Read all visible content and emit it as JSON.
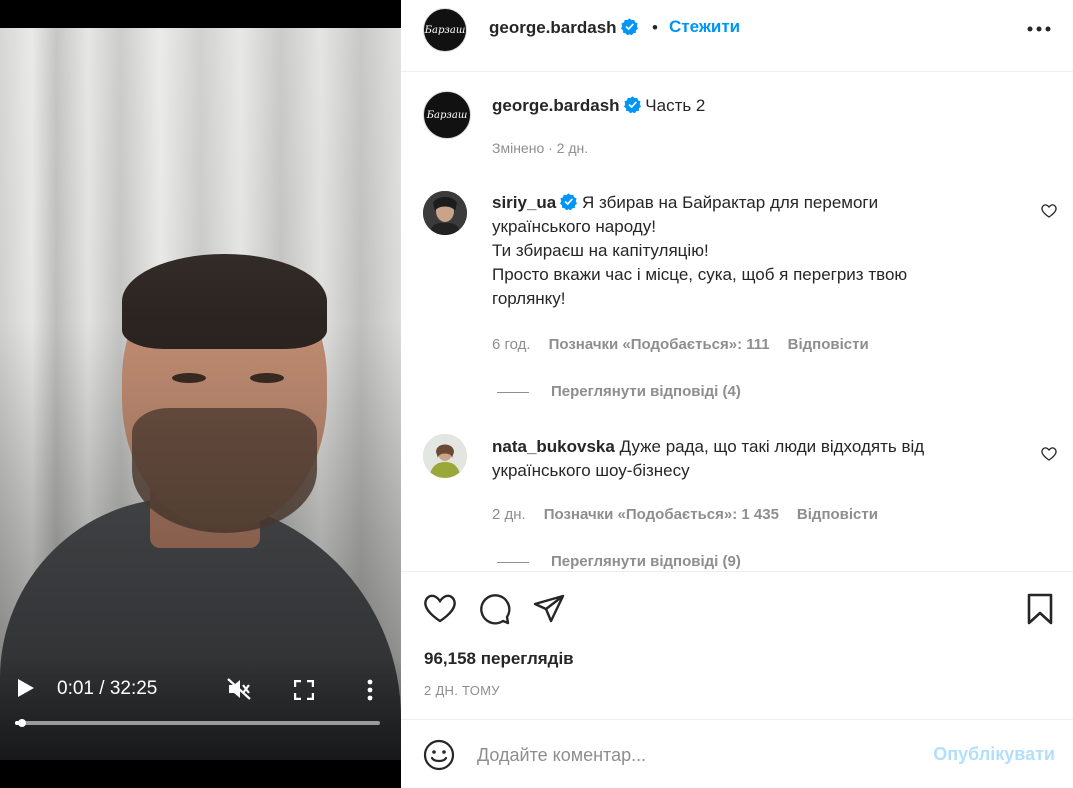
{
  "video": {
    "time_display": "0:01 / 32:25",
    "progress_fraction": 0.003,
    "icons": [
      "play-icon",
      "mute-icon",
      "fullscreen-icon",
      "more-vert-icon"
    ]
  },
  "header": {
    "avatar_text": "Барзаш",
    "username": "george.bardash",
    "verified_icon": "verified-badge-icon",
    "dot": "•",
    "follow_label": "Стежити",
    "more_icon": "more-horizontal-icon"
  },
  "caption": {
    "avatar_text": "Барзаш",
    "username": "george.bardash",
    "text": "Часть 2",
    "meta": "Змінено · 2 дн."
  },
  "comments": [
    {
      "username": "siriy_ua",
      "verified": true,
      "lines": [
        "Я збирав на Байрактар для перемоги",
        "українського народу!",
        "Ти збираєш на капітуляцію!",
        "Просто вкажи час і місце, сука, щоб я перегриз твою",
        "горлянку!"
      ],
      "age": "6 год.",
      "likes": "Позначки «Подобається»: 111",
      "reply": "Відповісти",
      "view_replies": "Переглянути відповіді (4)"
    },
    {
      "username": "nata_bukovska",
      "verified": false,
      "lines": [
        "Дуже рада, що такі люди відходять від",
        "українського шоу-бізнесу"
      ],
      "age": "2 дн.",
      "likes": "Позначки «Подобається»: 1 435",
      "reply": "Відповісти",
      "view_replies": "Переглянути відповіді (9)"
    }
  ],
  "actions": {
    "icons": [
      "heart-icon",
      "comment-icon",
      "share-icon",
      "bookmark-icon"
    ],
    "views": "96,158 переглядів",
    "ago": "2 ДН. ТОМУ"
  },
  "composer": {
    "emoji_icon": "emoji-icon",
    "placeholder": "Додайте коментар...",
    "publish_label": "Опублікувати"
  },
  "colors": {
    "accent": "#0095f6",
    "verified": "#0095f6",
    "muted_text": "#8e8e8e",
    "publish_disabled": "#b2dffc"
  }
}
